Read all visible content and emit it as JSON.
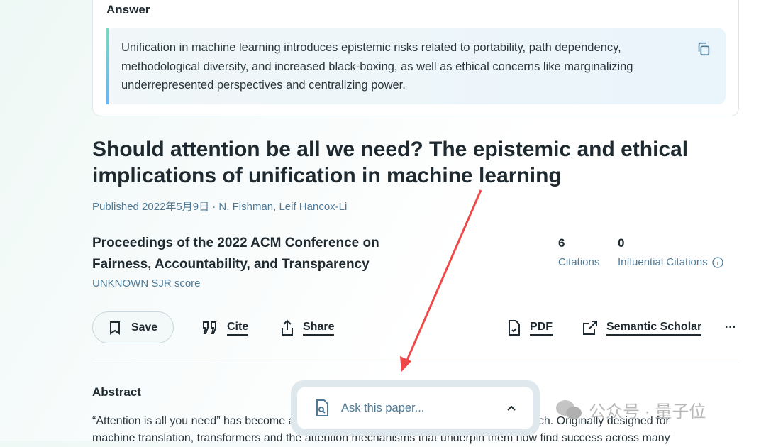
{
  "answer": {
    "label": "Answer",
    "text": "Unification in machine learning introduces epistemic risks related to portability, path dependency, methodological diversity, and increased black-boxing, as well as ethical concerns like marginalizing underrepresented perspectives and centralizing power.",
    "copy_icon": "copy-icon"
  },
  "paper": {
    "title": "Should attention be all we need? The epistemic and ethical implications of unification in machine learning",
    "published": "Published 2022年5月9日 · N. Fishman, Leif Hancox-Li",
    "venue": "Proceedings of the 2022 ACM Conference on Fairness, Accountability, and Transparency",
    "sjr": "UNKNOWN SJR score",
    "citations": {
      "value": "6",
      "label": "Citations"
    },
    "influential": {
      "value": "0",
      "label": "Influential Citations"
    }
  },
  "actions": {
    "save": "Save",
    "cite": "Cite",
    "share": "Share",
    "pdf": "PDF",
    "semantic_scholar": "Semantic Scholar",
    "more": "···"
  },
  "abstract": {
    "heading": "Abstract",
    "line1": "“Attention is all you need” has become a fundamental precept in machine learning research. Originally designed for",
    "line2": "machine translation, transformers and the attention mechanisms that underpin them now find success across many"
  },
  "ask": {
    "placeholder": "Ask this paper..."
  },
  "watermark": "公众号 · 量子位",
  "colors": {
    "accent": "#4e7a96",
    "annotation_arrow": "#f04848"
  }
}
